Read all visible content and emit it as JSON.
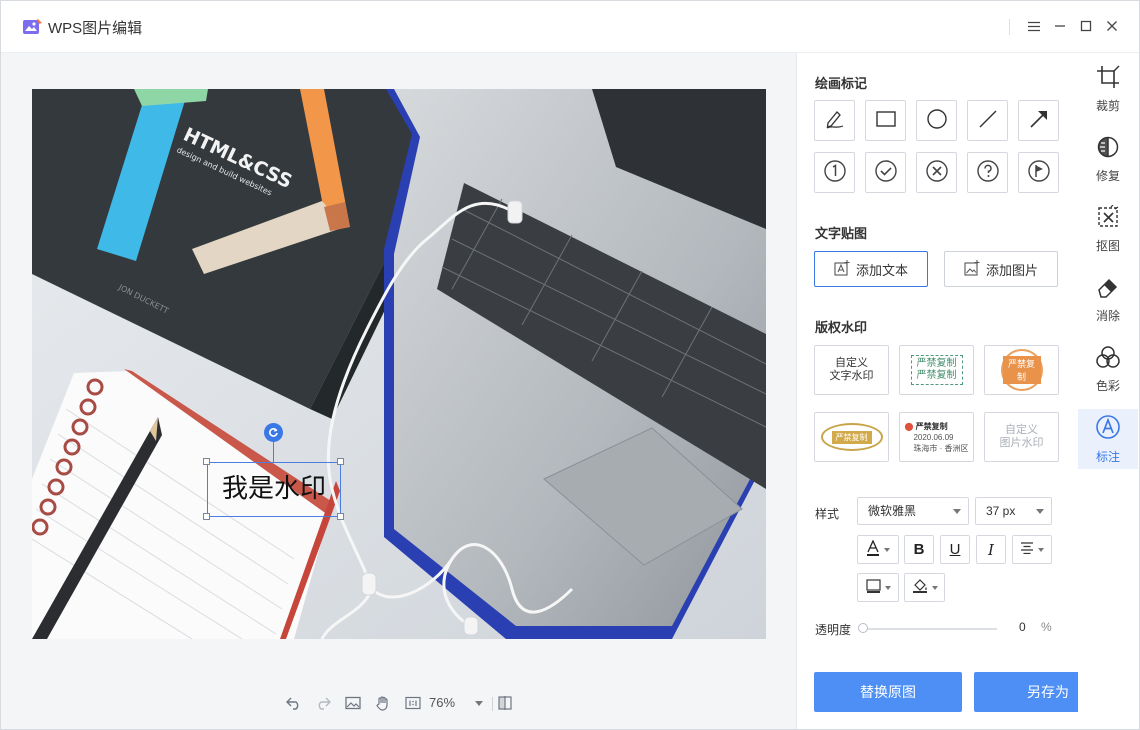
{
  "app": {
    "title": "WPS图片编辑"
  },
  "window_controls": [
    "menu-icon",
    "minimize-icon",
    "maximize-icon",
    "close-icon"
  ],
  "canvas": {
    "watermark_text": "我是水印",
    "photo_text": {
      "book_title": "HTML&CSS",
      "book_subtitle": "design and build websites",
      "book_author": "JON DUCKETT"
    }
  },
  "bottom_toolbar": {
    "zoom": "76%"
  },
  "panel": {
    "draw_title": "绘画标记",
    "draw_tools": [
      "pen-icon",
      "rectangle-icon",
      "circle-icon",
      "line-icon",
      "arrow-icon",
      "number-one-icon",
      "check-icon",
      "cross-icon",
      "question-icon",
      "flag-icon"
    ],
    "text_title": "文字贴图",
    "add_text": "添加文本",
    "add_image": "添加图片",
    "copyright_title": "版权水印",
    "watermarks": {
      "custom_text": "自定义\n文字水印",
      "stamp_a": "严禁复制",
      "stamp_b": "严禁复制",
      "stamp_c": "严禁复制",
      "stamp_d": "严禁复制",
      "loc_title": "严禁复制",
      "loc_date": "2020.06.09",
      "loc_place": "珠海市 · 香洲区",
      "custom_image": "自定义\n图片水印"
    },
    "style_label": "样式",
    "font_name": "微软雅黑",
    "font_size": "37 px",
    "opacity_label": "透明度",
    "opacity_value": "0",
    "opacity_unit": "%",
    "replace_btn": "替换原图",
    "save_as_btn": "另存为"
  },
  "right_tools": [
    "裁剪",
    "修复",
    "抠图",
    "消除",
    "色彩",
    "标注"
  ],
  "colors": {
    "accent": "#3a78e6",
    "primary_button": "#4d8ff5"
  }
}
